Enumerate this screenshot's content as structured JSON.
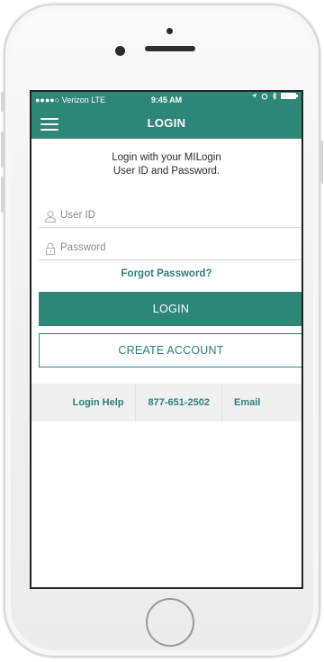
{
  "status_bar": {
    "carrier": "●●●●○ Verizon  LTE",
    "time": "9:45 AM"
  },
  "nav": {
    "title": "LOGIN",
    "menu_icon": "hamburger-icon"
  },
  "intro": {
    "line1": "Login with your MILogin",
    "line2": "User ID and Password."
  },
  "form": {
    "userid_placeholder": "User ID",
    "userid_value": "",
    "userid_icon": "user-icon",
    "password_placeholder": "Password",
    "password_value": "",
    "password_icon": "lock-icon",
    "forgot_label": "Forgot Password?",
    "login_label": "LOGIN",
    "create_label": "CREATE ACCOUNT"
  },
  "footer": {
    "help_label": "Login Help",
    "phone_label": "877-651-2502",
    "email_label": "Email"
  },
  "colors": {
    "brand": "#2d8676",
    "link": "#2d7e78",
    "footer_bg": "#f0f0f0"
  }
}
